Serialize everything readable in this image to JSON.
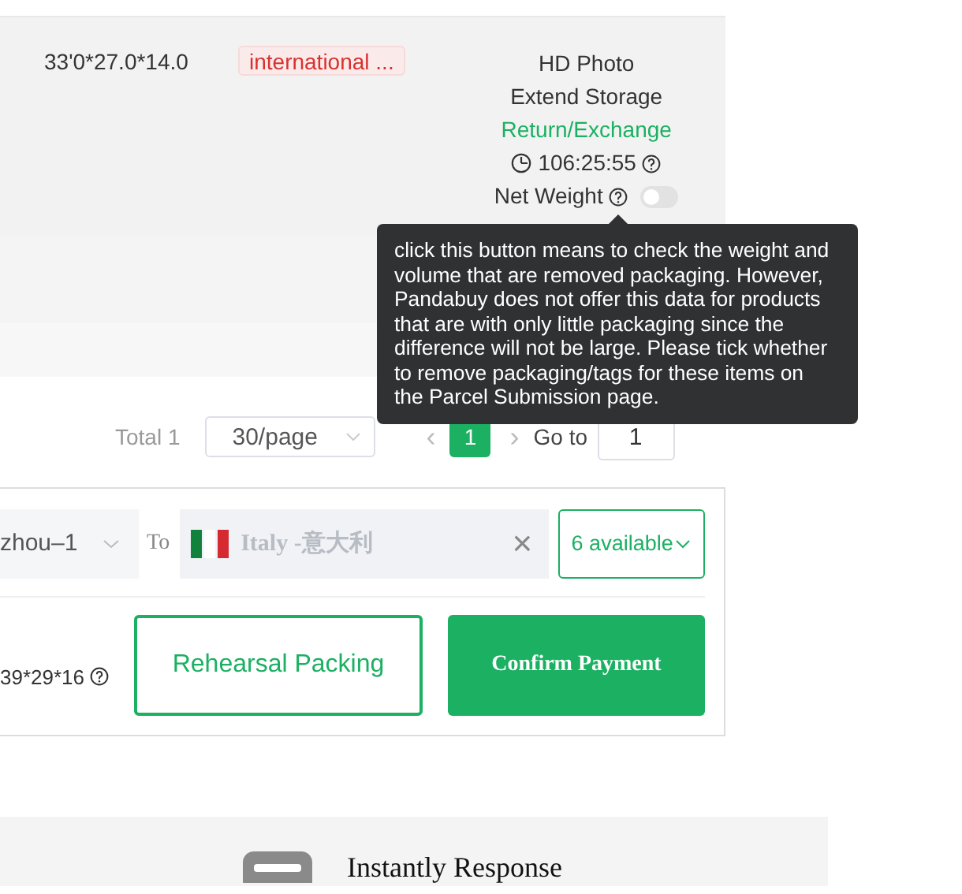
{
  "order": {
    "dimensions": "33'0*27.0*14.0",
    "tag": "international ...",
    "services": [
      {
        "label": "HD Photo",
        "kind": "plain"
      },
      {
        "label": "Extend Storage",
        "kind": "plain"
      },
      {
        "label": "Return/Exchange",
        "kind": "link"
      }
    ],
    "timer": "106:25:55",
    "net_weight": {
      "label": "Net Weight",
      "checked": false
    }
  },
  "tooltip": "click this button means to check the weight and volume that are removed packaging. However, Pandabuy does not offer this data for products that are with only little packaging since the difference will not be large. Please tick whether to remove packaging/tags for these items on the Parcel Submission page.",
  "pagination": {
    "total": "Total 1",
    "page_size": "30/page",
    "prev": "‹",
    "next": "›",
    "pages": [
      {
        "label": "1",
        "selected": true
      }
    ],
    "goto_label": "Go to",
    "goto_value": "1"
  },
  "shipping": {
    "from": "zhou–1",
    "to_label": "To",
    "to_value": "Italy -意大利",
    "clear": "×",
    "channels": "6 available",
    "size": "39*29*16",
    "buttons": [
      {
        "label": "Rehearsal Packing",
        "kind": "outline"
      },
      {
        "label": "Confirm Payment",
        "kind": "primary"
      }
    ]
  },
  "features": [
    {
      "label": "Instantly Response"
    }
  ]
}
